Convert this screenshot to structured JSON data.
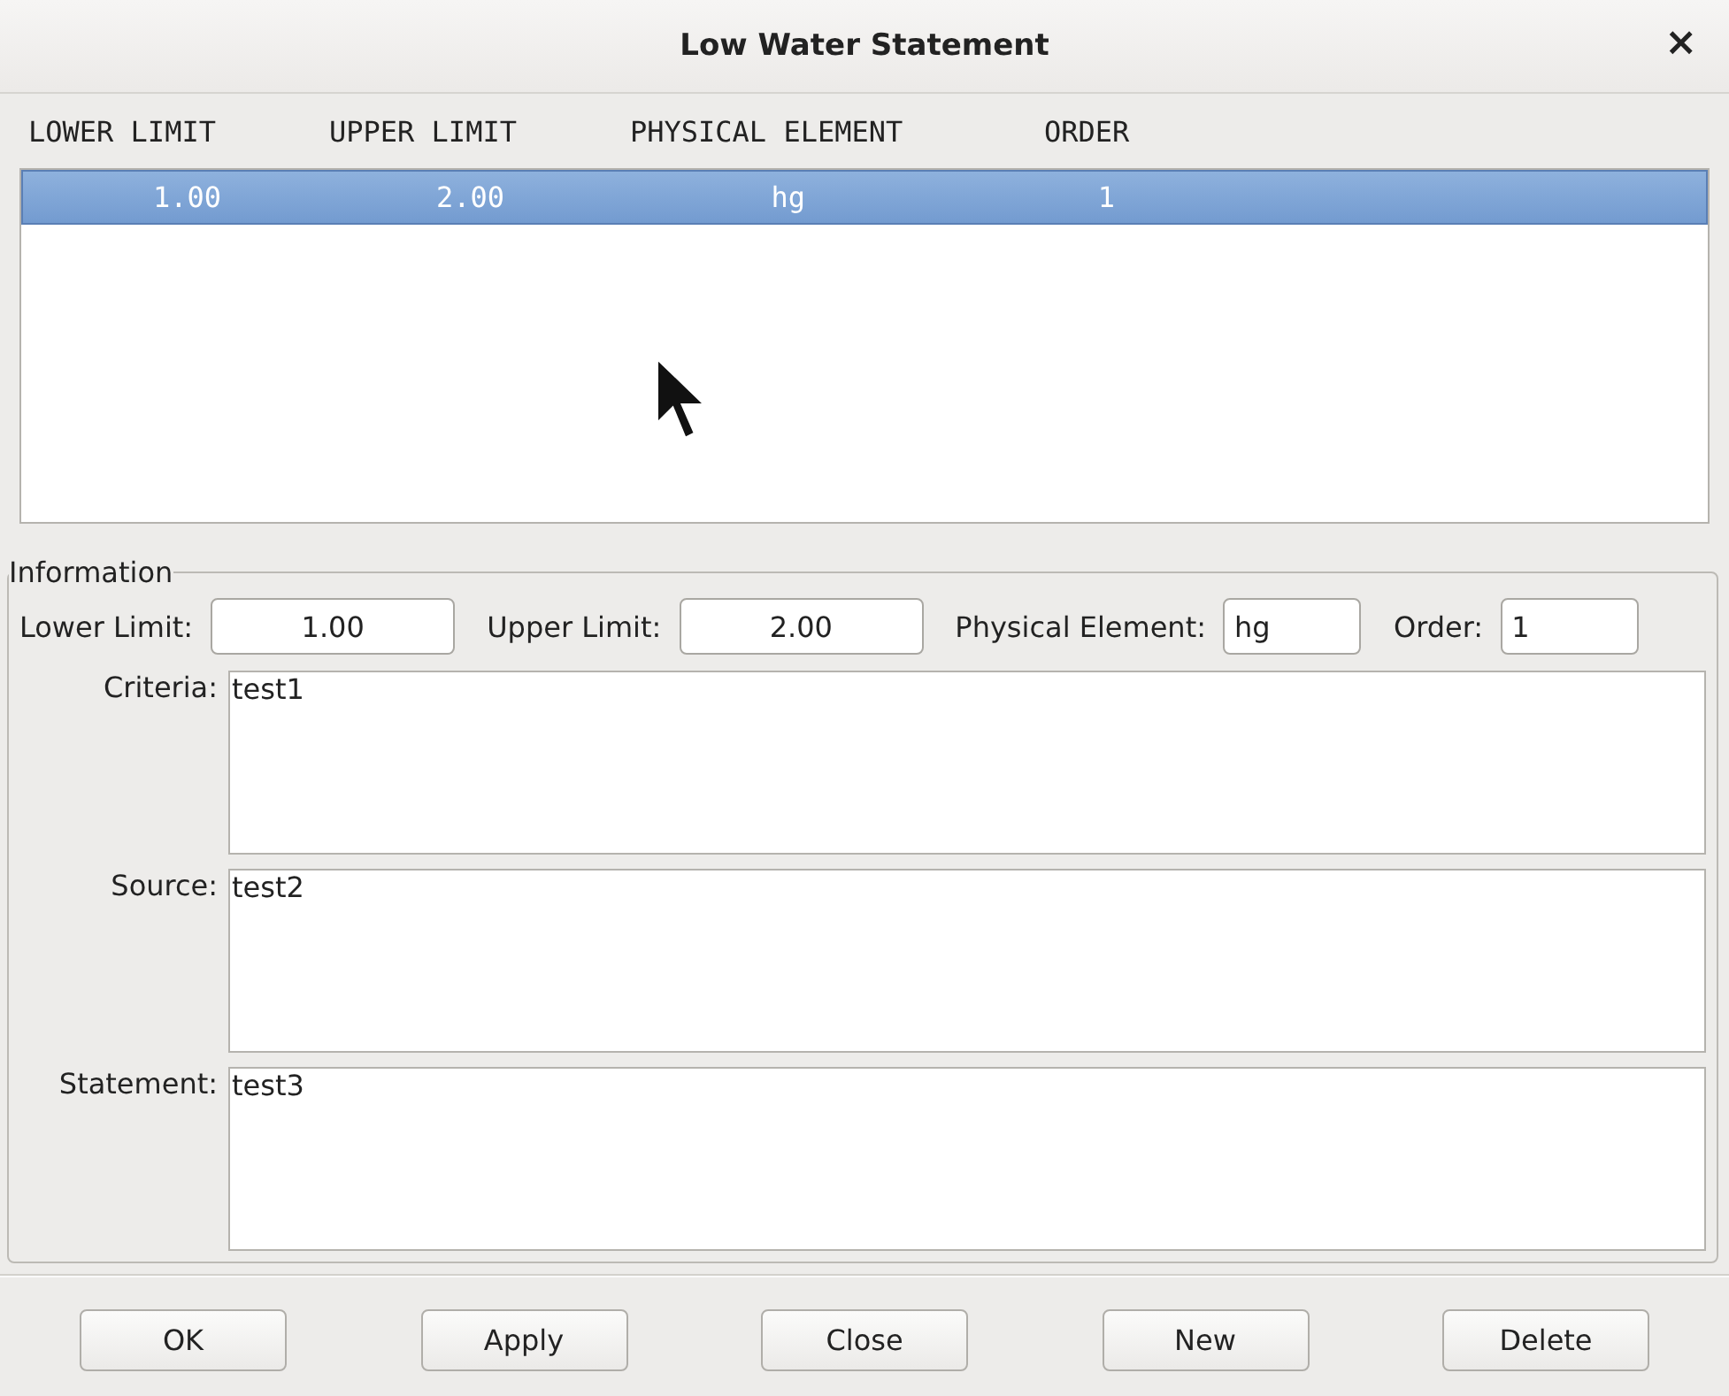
{
  "window": {
    "title": "Low Water Statement",
    "close": "×"
  },
  "table": {
    "columns": [
      "LOWER LIMIT",
      "UPPER LIMIT",
      "PHYSICAL ELEMENT",
      "ORDER"
    ],
    "rows": [
      {
        "cells": [
          "1.00",
          "2.00",
          "hg",
          "1"
        ],
        "selected": true
      }
    ]
  },
  "information": {
    "title": "Information",
    "fields": [
      {
        "label": "Lower Limit:",
        "value": "1.00"
      },
      {
        "label": "Upper Limit:",
        "value": "2.00"
      },
      {
        "label": "Physical Element:",
        "value": "hg"
      },
      {
        "label": "Order:",
        "value": "1"
      }
    ],
    "text_areas": [
      {
        "label": "Criteria:",
        "value": "test1"
      },
      {
        "label": "Source:",
        "value": "test2"
      },
      {
        "label": "Statement:",
        "value": "test3"
      }
    ]
  },
  "buttons": [
    "OK",
    "Apply",
    "Close",
    "New",
    "Delete"
  ]
}
